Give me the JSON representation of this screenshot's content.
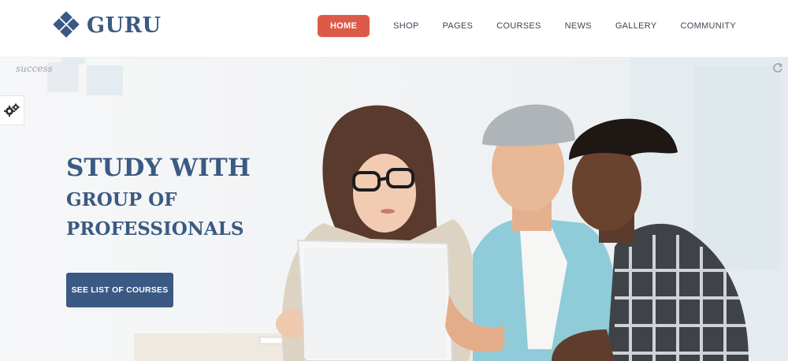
{
  "brand": {
    "name": "GURU",
    "color": "#3a5a83"
  },
  "nav": {
    "items": [
      {
        "label": "HOME",
        "active": true
      },
      {
        "label": "SHOP"
      },
      {
        "label": "PAGES"
      },
      {
        "label": "COURSES"
      },
      {
        "label": "NEWS"
      },
      {
        "label": "GALLERY"
      },
      {
        "label": "COMMUNITY"
      }
    ],
    "active_color": "#dd5a48"
  },
  "hero": {
    "title_line1": "STUDY WITH",
    "title_line2": "GROUP OF",
    "title_line3": "PROFESSIONALS",
    "cta_label": "SEE LIST OF COURSES",
    "whiteboard_text": "success",
    "image": "three students looking at a laptop"
  },
  "icons": {
    "settings": "gears-icon",
    "corner": "refresh-icon"
  }
}
